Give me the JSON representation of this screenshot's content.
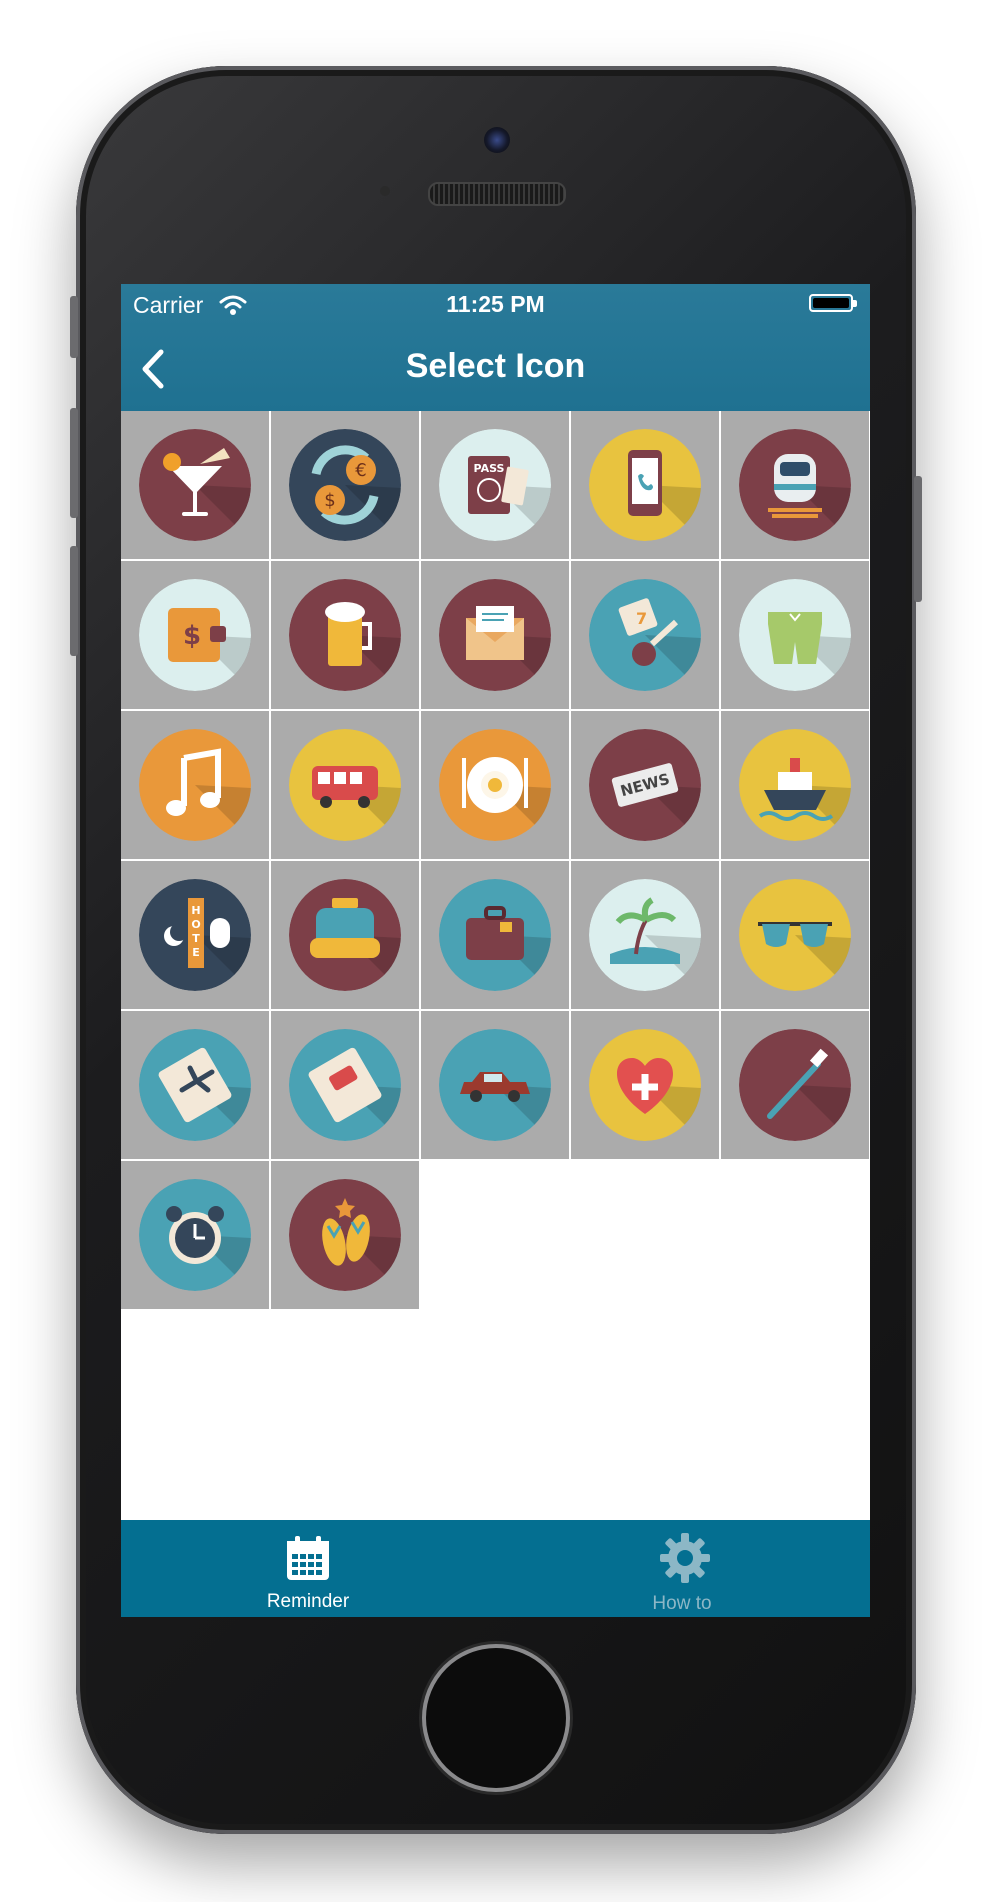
{
  "status_bar": {
    "carrier": "Carrier",
    "time": "11:25 PM"
  },
  "nav": {
    "title": "Select Icon",
    "back_icon": "chevron-left-icon"
  },
  "icons": [
    "cocktail-icon",
    "currency-exchange-icon",
    "passport-icon",
    "mobile-phone-icon",
    "train-icon",
    "wallet-icon",
    "beer-icon",
    "envelope-icon",
    "room-key-icon",
    "swim-shorts-icon",
    "music-note-icon",
    "bus-icon",
    "breakfast-plate-icon",
    "newspaper-icon",
    "cruise-ship-icon",
    "hotel-icon",
    "taxi-icon",
    "suitcase-icon",
    "palm-island-icon",
    "sunglasses-icon",
    "plane-ticket-icon",
    "bus-ticket-icon",
    "car-icon",
    "health-heart-icon",
    "toothbrush-icon",
    "alarm-clock-icon",
    "flip-flops-icon"
  ],
  "tabs": [
    {
      "label": "Reminder",
      "icon": "calendar-icon",
      "active": true
    },
    {
      "label": "How to",
      "icon": "gear-icon",
      "active": false
    }
  ],
  "colors": {
    "nav_bar": "#1f7191",
    "tab_bar": "#046f91",
    "cell_background": "#ababab",
    "maroon": "#7d3f48",
    "navy": "#34465a",
    "yellow": "#e8c33f",
    "orange": "#e9983a",
    "teal": "#4aa2b4",
    "pale": "#dcefee"
  }
}
